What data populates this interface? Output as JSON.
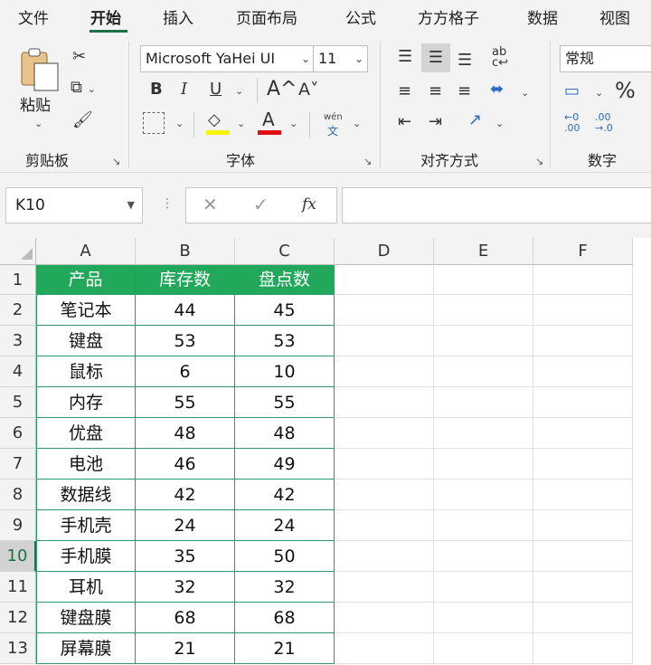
{
  "menu": {
    "tabs": [
      "文件",
      "开始",
      "插入",
      "页面布局",
      "公式",
      "方方格子",
      "数据",
      "视图"
    ],
    "active": "开始"
  },
  "ribbon": {
    "clipboard": {
      "paste_label": "粘贴",
      "group_label": "剪贴板"
    },
    "font": {
      "font_name": "Microsoft YaHei UI",
      "font_size": "11",
      "bold": "B",
      "italic": "I",
      "underline": "U",
      "grow": "A^",
      "shrink": "A˅",
      "phonetic_top": "wén",
      "phonetic_bottom": "文",
      "group_label": "字体"
    },
    "alignment": {
      "group_label": "对齐方式"
    },
    "number": {
      "format": "常规",
      "percent": "%",
      "group_label": "数字"
    }
  },
  "formula_bar": {
    "name_box": "K10",
    "fx": "fx",
    "formula": ""
  },
  "sheet": {
    "columns": [
      "A",
      "B",
      "C",
      "D",
      "E",
      "F"
    ],
    "selected_row": 10,
    "header": [
      "产品",
      "库存数",
      "盘点数"
    ],
    "rows": [
      [
        "笔记本",
        "44",
        "45"
      ],
      [
        "键盘",
        "53",
        "53"
      ],
      [
        "鼠标",
        "6",
        "10"
      ],
      [
        "内存",
        "55",
        "55"
      ],
      [
        "优盘",
        "48",
        "48"
      ],
      [
        "电池",
        "46",
        "49"
      ],
      [
        "数据线",
        "42",
        "42"
      ],
      [
        "手机壳",
        "24",
        "24"
      ],
      [
        "手机膜",
        "35",
        "50"
      ],
      [
        "耳机",
        "32",
        "32"
      ],
      [
        "键盘膜",
        "68",
        "68"
      ],
      [
        "屏幕膜",
        "21",
        "21"
      ]
    ]
  },
  "colors": {
    "accent": "#1e7145",
    "header_fill": "#21a85a",
    "table_border": "#2e9a6a"
  }
}
